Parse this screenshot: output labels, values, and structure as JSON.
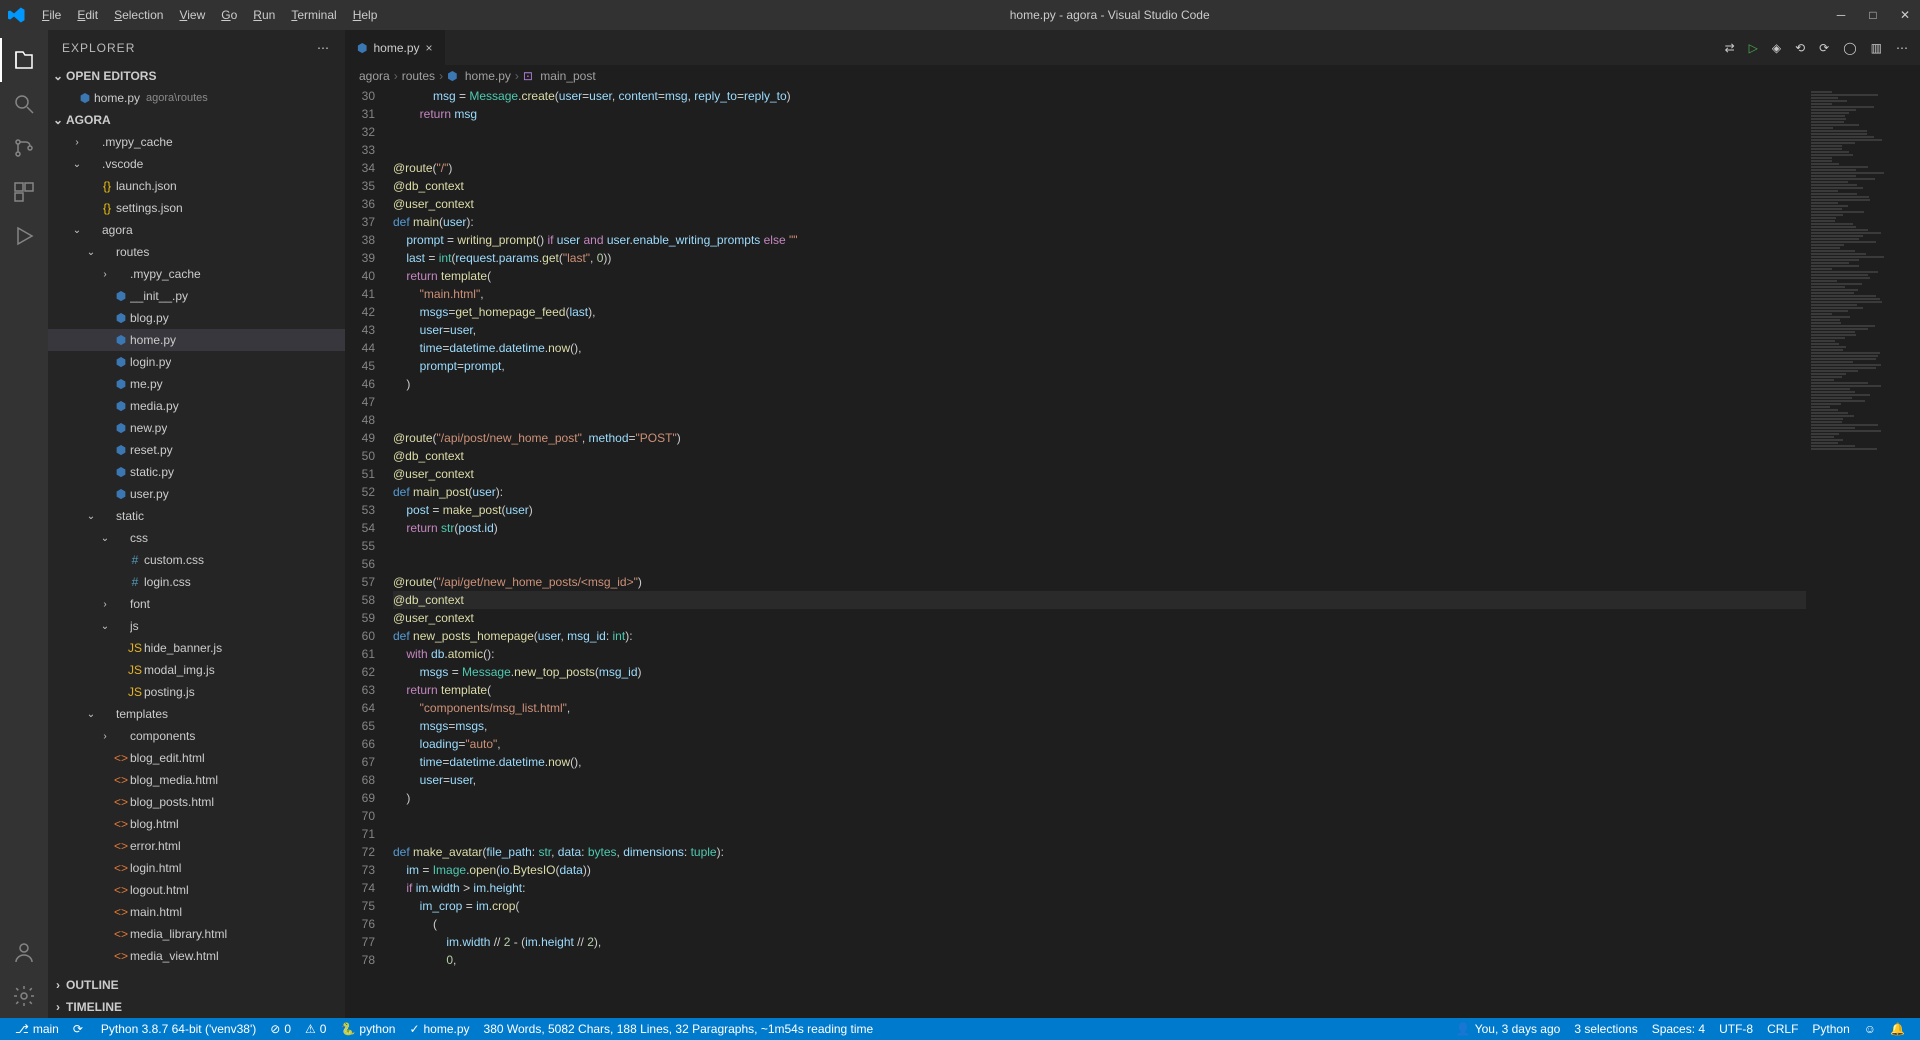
{
  "titlebar": {
    "menus": [
      "File",
      "Edit",
      "Selection",
      "View",
      "Go",
      "Run",
      "Terminal",
      "Help"
    ],
    "title": "home.py - agora - Visual Studio Code"
  },
  "activity": {
    "items": [
      "files",
      "search",
      "scm",
      "run",
      "extensions"
    ],
    "bottom": [
      "account",
      "gear"
    ]
  },
  "sidebar": {
    "title": "EXPLORER",
    "open_editors_label": "OPEN EDITORS",
    "open_editors": [
      {
        "name": "home.py",
        "hint": "agora\\routes",
        "icon": "py"
      }
    ],
    "project": "AGORA",
    "outline_label": "OUTLINE",
    "timeline_label": "TIMELINE",
    "tree": [
      {
        "d": 1,
        "t": "folder-c",
        "n": ".mypy_cache"
      },
      {
        "d": 1,
        "t": "folder-o",
        "n": ".vscode"
      },
      {
        "d": 2,
        "t": "json",
        "n": "launch.json"
      },
      {
        "d": 2,
        "t": "json",
        "n": "settings.json"
      },
      {
        "d": 1,
        "t": "folder-o",
        "n": "agora"
      },
      {
        "d": 2,
        "t": "folder-o",
        "n": "routes"
      },
      {
        "d": 3,
        "t": "folder-c",
        "n": ".mypy_cache"
      },
      {
        "d": 3,
        "t": "py",
        "n": "__init__.py"
      },
      {
        "d": 3,
        "t": "py",
        "n": "blog.py"
      },
      {
        "d": 3,
        "t": "py",
        "n": "home.py",
        "sel": true
      },
      {
        "d": 3,
        "t": "py",
        "n": "login.py"
      },
      {
        "d": 3,
        "t": "py",
        "n": "me.py"
      },
      {
        "d": 3,
        "t": "py",
        "n": "media.py"
      },
      {
        "d": 3,
        "t": "py",
        "n": "new.py"
      },
      {
        "d": 3,
        "t": "py",
        "n": "reset.py"
      },
      {
        "d": 3,
        "t": "py",
        "n": "static.py"
      },
      {
        "d": 3,
        "t": "py",
        "n": "user.py"
      },
      {
        "d": 2,
        "t": "folder-o",
        "n": "static"
      },
      {
        "d": 3,
        "t": "folder-o",
        "n": "css"
      },
      {
        "d": 4,
        "t": "css",
        "n": "custom.css"
      },
      {
        "d": 4,
        "t": "css",
        "n": "login.css"
      },
      {
        "d": 3,
        "t": "folder-c",
        "n": "font"
      },
      {
        "d": 3,
        "t": "folder-o",
        "n": "js"
      },
      {
        "d": 4,
        "t": "js",
        "n": "hide_banner.js"
      },
      {
        "d": 4,
        "t": "js",
        "n": "modal_img.js"
      },
      {
        "d": 4,
        "t": "js",
        "n": "posting.js"
      },
      {
        "d": 2,
        "t": "folder-o",
        "n": "templates"
      },
      {
        "d": 3,
        "t": "folder-c",
        "n": "components"
      },
      {
        "d": 3,
        "t": "html",
        "n": "blog_edit.html"
      },
      {
        "d": 3,
        "t": "html",
        "n": "blog_media.html"
      },
      {
        "d": 3,
        "t": "html",
        "n": "blog_posts.html"
      },
      {
        "d": 3,
        "t": "html",
        "n": "blog.html"
      },
      {
        "d": 3,
        "t": "html",
        "n": "error.html"
      },
      {
        "d": 3,
        "t": "html",
        "n": "login.html"
      },
      {
        "d": 3,
        "t": "html",
        "n": "logout.html"
      },
      {
        "d": 3,
        "t": "html",
        "n": "main.html"
      },
      {
        "d": 3,
        "t": "html",
        "n": "media_library.html"
      },
      {
        "d": 3,
        "t": "html",
        "n": "media_view.html"
      }
    ]
  },
  "tabs": {
    "active": {
      "name": "home.py",
      "icon": "py"
    }
  },
  "breadcrumbs": [
    "agora",
    "routes",
    "home.py",
    "main_post"
  ],
  "bc_icons": [
    "",
    "",
    "py",
    "fn"
  ],
  "code": {
    "first_line": 30,
    "current_line": 58,
    "lines": [
      "            <span class='tok-var'>msg</span> <span class='tok-op'>=</span> <span class='tok-cls'>Message</span>.<span class='tok-fn'>create</span>(<span class='tok-var'>user</span><span class='tok-op'>=</span><span class='tok-var'>user</span>, <span class='tok-var'>content</span><span class='tok-op'>=</span><span class='tok-var'>msg</span>, <span class='tok-var'>reply_to</span><span class='tok-op'>=</span><span class='tok-var'>reply_to</span>)",
      "        <span class='tok-kw'>return</span> <span class='tok-var'>msg</span>",
      "",
      "",
      "<span class='tok-dec'>@route</span>(<span class='tok-str'>\"/\"</span>)",
      "<span class='tok-dec'>@db_context</span>",
      "<span class='tok-dec'>@user_context</span>",
      "<span class='tok-def'>def</span> <span class='tok-fn'>main</span>(<span class='tok-var'>user</span>):",
      "    <span class='tok-var'>prompt</span> <span class='tok-op'>=</span> <span class='tok-fn'>writing_prompt</span>() <span class='tok-kw'>if</span> <span class='tok-var'>user</span> <span class='tok-kw'>and</span> <span class='tok-var'>user</span>.<span class='tok-var'>enable_writing_prompts</span> <span class='tok-kw'>else</span> <span class='tok-str'>\"\"</span>",
      "    <span class='tok-var'>last</span> <span class='tok-op'>=</span> <span class='tok-cls'>int</span>(<span class='tok-var'>request</span>.<span class='tok-var'>params</span>.<span class='tok-fn'>get</span>(<span class='tok-str'>\"last\"</span>, <span class='tok-num'>0</span>))",
      "    <span class='tok-kw'>return</span> <span class='tok-fn'>template</span>(",
      "        <span class='tok-str'>\"main.html\"</span>,",
      "        <span class='tok-var'>msgs</span><span class='tok-op'>=</span><span class='tok-fn'>get_homepage_feed</span>(<span class='tok-var'>last</span>),",
      "        <span class='tok-var'>user</span><span class='tok-op'>=</span><span class='tok-var'>user</span>,",
      "        <span class='tok-var'>time</span><span class='tok-op'>=</span><span class='tok-var'>datetime</span>.<span class='tok-var'>datetime</span>.<span class='tok-fn'>now</span>(),",
      "        <span class='tok-var'>prompt</span><span class='tok-op'>=</span><span class='tok-var'>prompt</span>,",
      "    )",
      "",
      "",
      "<span class='tok-dec'>@route</span>(<span class='tok-str'>\"/api/post/new_home_post\"</span>, <span class='tok-var'>method</span><span class='tok-op'>=</span><span class='tok-str'>\"POST\"</span>)",
      "<span class='tok-dec'>@db_context</span>",
      "<span class='tok-dec'>@user_context</span>",
      "<span class='tok-def'>def</span> <span class='tok-fn'>main_post</span>(<span class='tok-var'>user</span>):",
      "    <span class='tok-var'>post</span> <span class='tok-op'>=</span> <span class='tok-fn'>make_post</span>(<span class='tok-var'>user</span>)",
      "    <span class='tok-kw'>return</span> <span class='tok-cls'>str</span>(<span class='tok-var'>post</span>.<span class='tok-var'>id</span>)",
      "",
      "",
      "<span class='tok-dec'>@route</span>(<span class='tok-str'>\"/api/get/new_home_posts/&lt;msg_id&gt;\"</span>)",
      "<span class='tok-dec'>@db_context</span>",
      "<span class='tok-dec'>@user_context</span>",
      "<span class='tok-def'>def</span> <span class='tok-fn'>new_posts_homepage</span>(<span class='tok-var'>user</span>, <span class='tok-var'>msg_id</span>: <span class='tok-cls'>int</span>):",
      "    <span class='tok-kw'>with</span> <span class='tok-var'>db</span>.<span class='tok-fn'>atomic</span>():",
      "        <span class='tok-var'>msgs</span> <span class='tok-op'>=</span> <span class='tok-cls'>Message</span>.<span class='tok-fn'>new_top_posts</span>(<span class='tok-var'>msg_id</span>)",
      "    <span class='tok-kw'>return</span> <span class='tok-fn'>template</span>(",
      "        <span class='tok-str'>\"components/msg_list.html\"</span>,",
      "        <span class='tok-var'>msgs</span><span class='tok-op'>=</span><span class='tok-var'>msgs</span>,",
      "        <span class='tok-var'>loading</span><span class='tok-op'>=</span><span class='tok-str'>\"auto\"</span>,",
      "        <span class='tok-var'>time</span><span class='tok-op'>=</span><span class='tok-var'>datetime</span>.<span class='tok-var'>datetime</span>.<span class='tok-fn'>now</span>(),",
      "        <span class='tok-var'>user</span><span class='tok-op'>=</span><span class='tok-var'>user</span>,",
      "    )",
      "",
      "",
      "<span class='tok-def'>def</span> <span class='tok-fn'>make_avatar</span>(<span class='tok-var'>file_path</span>: <span class='tok-cls'>str</span>, <span class='tok-var'>data</span>: <span class='tok-cls'>bytes</span>, <span class='tok-var'>dimensions</span>: <span class='tok-cls'>tuple</span>):",
      "    <span class='tok-var'>im</span> <span class='tok-op'>=</span> <span class='tok-cls'>Image</span>.<span class='tok-fn'>open</span>(<span class='tok-var'>io</span>.<span class='tok-fn'>BytesIO</span>(<span class='tok-var'>data</span>))",
      "    <span class='tok-kw'>if</span> <span class='tok-var'>im</span>.<span class='tok-var'>width</span> <span class='tok-op'>&gt;</span> <span class='tok-var'>im</span>.<span class='tok-var'>height</span>:",
      "        <span class='tok-var'>im_crop</span> <span class='tok-op'>=</span> <span class='tok-var'>im</span>.<span class='tok-fn'>crop</span>(",
      "            (",
      "                <span class='tok-var'>im</span>.<span class='tok-var'>width</span> <span class='tok-op'>//</span> <span class='tok-num'>2</span> <span class='tok-op'>-</span> (<span class='tok-var'>im</span>.<span class='tok-var'>height</span> <span class='tok-op'>//</span> <span class='tok-num'>2</span>),",
      "                <span class='tok-num'>0</span>,"
    ]
  },
  "status": {
    "left": [
      {
        "icon": "branch",
        "text": "main"
      },
      {
        "icon": "sync",
        "text": ""
      },
      {
        "icon": "",
        "text": "Python 3.8.7 64-bit ('venv38')"
      },
      {
        "icon": "err",
        "text": "0"
      },
      {
        "icon": "warn",
        "text": "0"
      },
      {
        "icon": "py",
        "text": "python"
      },
      {
        "icon": "check",
        "text": "home.py"
      },
      {
        "icon": "",
        "text": "380 Words, 5082 Chars, 188 Lines, 32 Paragraphs, ~1m54s reading time"
      }
    ],
    "right": [
      {
        "icon": "user",
        "text": "You, 3 days ago"
      },
      {
        "text": "3 selections"
      },
      {
        "text": "Spaces: 4"
      },
      {
        "text": "UTF-8"
      },
      {
        "text": "CRLF"
      },
      {
        "text": "Python"
      },
      {
        "icon": "smile",
        "text": ""
      },
      {
        "icon": "bell",
        "text": ""
      }
    ]
  }
}
